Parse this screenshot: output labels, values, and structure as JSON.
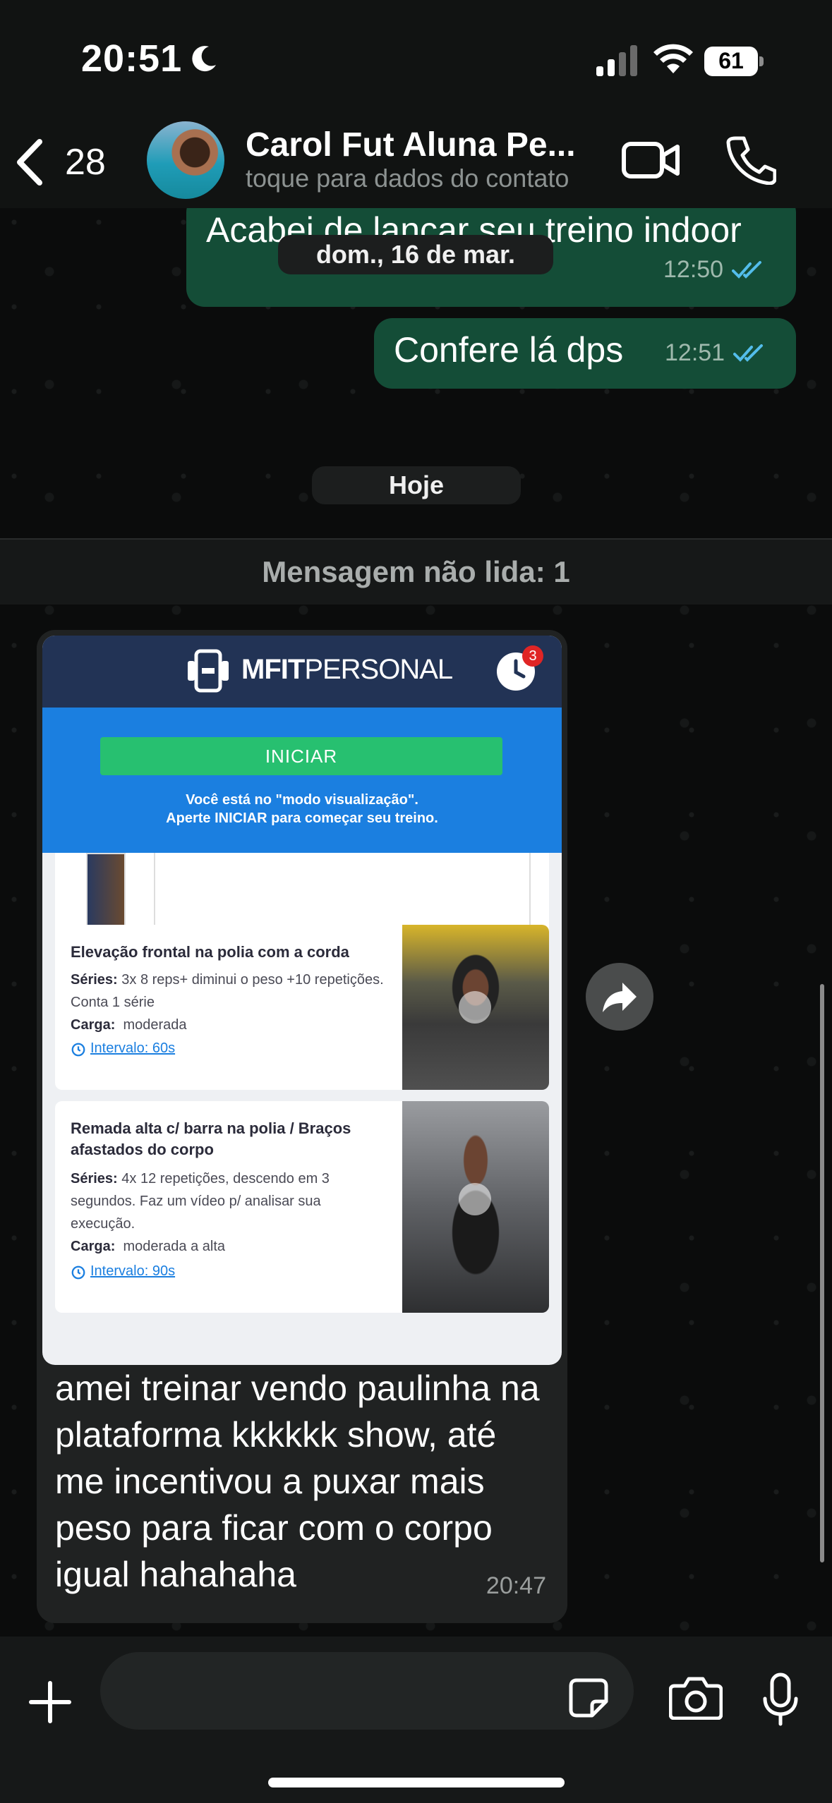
{
  "status_bar": {
    "time": "20:51",
    "battery": "61",
    "battery_level": 0.61
  },
  "header": {
    "back_count": "28",
    "contact_name": "Carol Fut Aluna Pe...",
    "contact_subtitle": "toque para dados do contato"
  },
  "messages": {
    "partial_out": {
      "text": "Acabei de lançar seu treino indoor",
      "time": "12:50"
    },
    "date_overlay": "dom., 16 de mar.",
    "out_2": {
      "text": "Confere lá dps",
      "time": "12:51"
    },
    "today_pill": "Hoje",
    "unread_label": "Mensagem não lida: 1",
    "incoming": {
      "caption": "amei treinar vendo paulinha na plataforma kkkkkk show, até me incentivou a puxar mais peso para ficar com o corpo igual hahahaha",
      "time": "20:47"
    }
  },
  "mfit": {
    "brand_bold": "MFIT",
    "brand_light": "PERSONAL",
    "badge": "3",
    "start_label": "INICIAR",
    "note_line1": "Você está no \"modo visualização\".",
    "note_line2": "Aperte INICIAR para começar seu treino.",
    "exercises": [
      {
        "title": "Elevação frontal na polia com a corda",
        "series_label": "Séries:",
        "series": "3x 8 reps+ diminui o peso +10 repetições. Conta 1 série",
        "load_label": "Carga:",
        "load": "moderada",
        "interval": "Intervalo: 60s"
      },
      {
        "title": "Remada alta c/ barra na polia / Braços afastados do corpo",
        "series_label": "Séries:",
        "series": "4x 12 repetições, descendo em 3 segundos. Faz um vídeo p/ analisar sua execução.",
        "load_label": "Carga:",
        "load": "moderada a alta",
        "interval": "Intervalo: 90s"
      }
    ]
  },
  "colors": {
    "outgoing_bubble": "#144d37",
    "incoming_bubble": "#202222",
    "read_ticks": "#53bdeb",
    "mfit_blue": "#1b7fe0",
    "mfit_green": "#27c070"
  }
}
